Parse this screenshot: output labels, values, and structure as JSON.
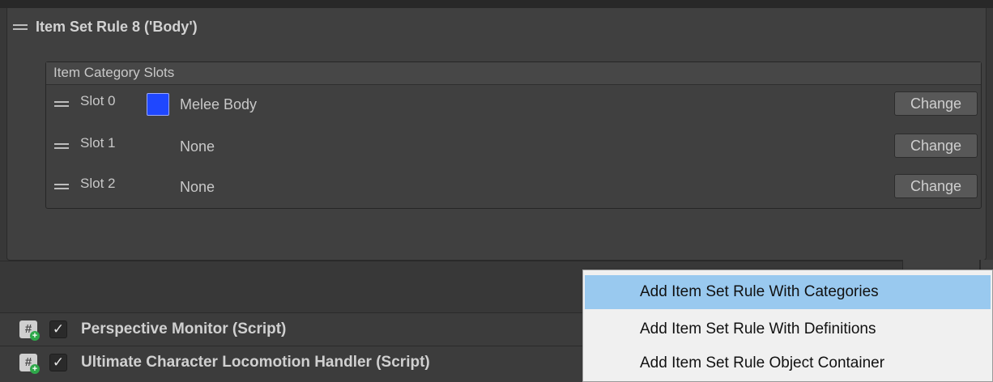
{
  "rule": {
    "title": "Item Set Rule 8 ('Body')"
  },
  "slots": {
    "title": "Item Category Slots",
    "change_label": "Change",
    "rows": [
      {
        "label": "Slot 0",
        "value": "Melee Body",
        "swatch_color": "#1f47ff"
      },
      {
        "label": "Slot 1",
        "value": "None"
      },
      {
        "label": "Slot 2",
        "value": "None"
      }
    ]
  },
  "components": [
    {
      "title": "Perspective Monitor (Script)",
      "checked": true
    },
    {
      "title": "Ultimate Character Locomotion Handler (Script)",
      "checked": true
    }
  ],
  "context_menu": {
    "items": [
      {
        "label": "Add Item Set Rule With Categories",
        "highlighted": true
      },
      {
        "label": "Add Item Set Rule With Definitions",
        "highlighted": false
      },
      {
        "label": "Add Item Set Rule Object Container",
        "highlighted": false
      }
    ]
  },
  "colors": {
    "highlight": "#99c9ef",
    "swatch": "#1f47ff"
  }
}
